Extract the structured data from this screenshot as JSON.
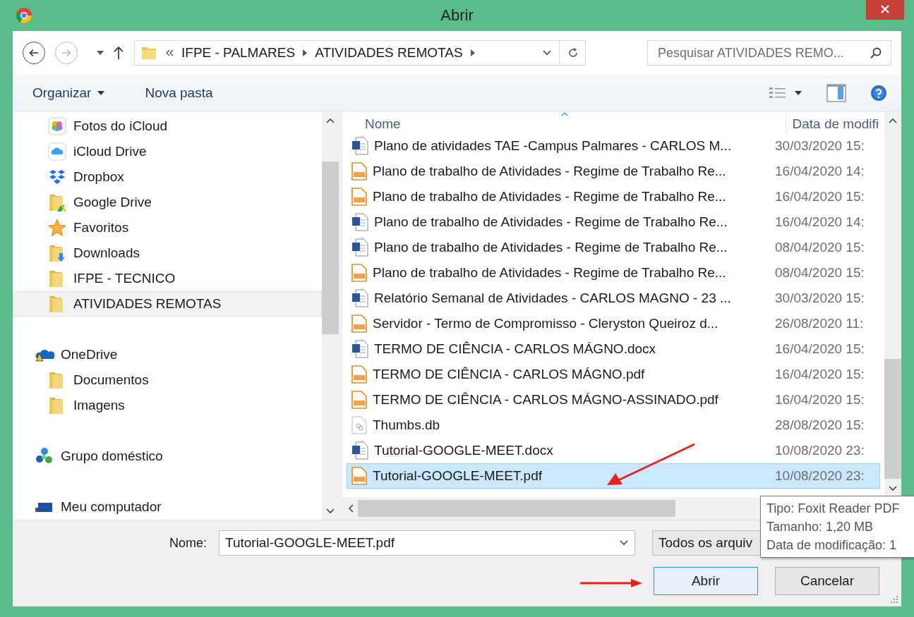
{
  "window": {
    "title": "Abrir"
  },
  "navigation": {
    "back_enabled": true,
    "forward_enabled": false
  },
  "breadcrumb": [
    "IFPE - PALMARES",
    "ATIVIDADES REMOTAS"
  ],
  "search": {
    "placeholder": "Pesquisar ATIVIDADES REMO..."
  },
  "toolbar": [
    {
      "label": "Organizar",
      "kind": "menu"
    },
    {
      "label": "Nova pasta",
      "kind": "button"
    }
  ],
  "nav": {
    "items": [
      {
        "label": "Fotos do iCloud",
        "selected": false
      },
      {
        "label": "iCloud Drive",
        "selected": false
      },
      {
        "label": "Dropbox",
        "selected": false
      },
      {
        "label": "Google Drive",
        "selected": false
      },
      {
        "label": "Favoritos",
        "selected": false
      },
      {
        "label": "Downloads",
        "selected": false
      },
      {
        "label": "IFPE - TECNICO",
        "selected": false
      },
      {
        "label": "ATIVIDADES REMOTAS",
        "selected": true
      }
    ],
    "groups": [
      {
        "label": "OneDrive",
        "selected": false,
        "children": [
          {
            "label": "Documentos",
            "selected": false
          },
          {
            "label": "Imagens",
            "selected": false
          }
        ]
      },
      {
        "label": "Grupo doméstico",
        "selected": false
      },
      {
        "label": "Meu computador",
        "selected": false
      }
    ]
  },
  "file_list": {
    "columns": [
      "Nome",
      "Data de modifi"
    ],
    "rows": [
      {
        "name": "Plano de atividades TAE -Campus Palmares - CARLOS M...",
        "date": "30/03/2020 15:",
        "kind": "word",
        "selected": false
      },
      {
        "name": "Plano de trabalho de Atividades - Regime de Trabalho Re...",
        "date": "16/04/2020 14:",
        "kind": "pdf",
        "selected": false
      },
      {
        "name": "Plano de trabalho de Atividades - Regime de Trabalho Re...",
        "date": "16/04/2020 15:",
        "kind": "pdf",
        "selected": false
      },
      {
        "name": "Plano de trabalho de Atividades - Regime de Trabalho Re...",
        "date": "16/04/2020 14:",
        "kind": "word",
        "selected": false
      },
      {
        "name": "Plano de trabalho de Atividades - Regime de Trabalho Re...",
        "date": "08/04/2020 15:",
        "kind": "word",
        "selected": false
      },
      {
        "name": "Plano de trabalho de Atividades - Regime de Trabalho Re...",
        "date": "08/04/2020 15:",
        "kind": "pdf",
        "selected": false
      },
      {
        "name": "Relatório Semanal de Atividades - CARLOS MAGNO - 23 ...",
        "date": "30/03/2020 15:",
        "kind": "word",
        "selected": false
      },
      {
        "name": "Servidor - Termo de Compromisso - Cleryston Queiroz d...",
        "date": "26/08/2020 11:",
        "kind": "pdf",
        "selected": false
      },
      {
        "name": "TERMO DE CIÊNCIA - CARLOS MÁGNO.docx",
        "date": "16/04/2020 15:",
        "kind": "word",
        "selected": false
      },
      {
        "name": "TERMO DE CIÊNCIA - CARLOS MÁGNO.pdf",
        "date": "16/04/2020 15:",
        "kind": "pdf",
        "selected": false
      },
      {
        "name": "TERMO DE CIÊNCIA - CARLOS MÁGNO-ASSINADO.pdf",
        "date": "16/04/2020 15:",
        "kind": "pdf",
        "selected": false
      },
      {
        "name": "Thumbs.db",
        "date": "28/08/2020 15:",
        "kind": "db",
        "selected": false
      },
      {
        "name": "Tutorial-GOOGLE-MEET.docx",
        "date": "10/08/2020 23:",
        "kind": "word",
        "selected": false
      },
      {
        "name": "Tutorial-GOOGLE-MEET.pdf",
        "date": "10/08/2020 23:",
        "kind": "pdf",
        "selected": true
      }
    ]
  },
  "file_name": {
    "label": "Nome:",
    "value": "Tutorial-GOOGLE-MEET.pdf"
  },
  "file_type": "Todos os arquiv",
  "buttons": [
    {
      "label": "Abrir",
      "default": true
    },
    {
      "label": "Cancelar",
      "default": false
    }
  ],
  "tooltip": [
    "Tipo: Foxit Reader PDF",
    "Tamanho: 1,20 MB",
    "Data de modificação: 1"
  ]
}
